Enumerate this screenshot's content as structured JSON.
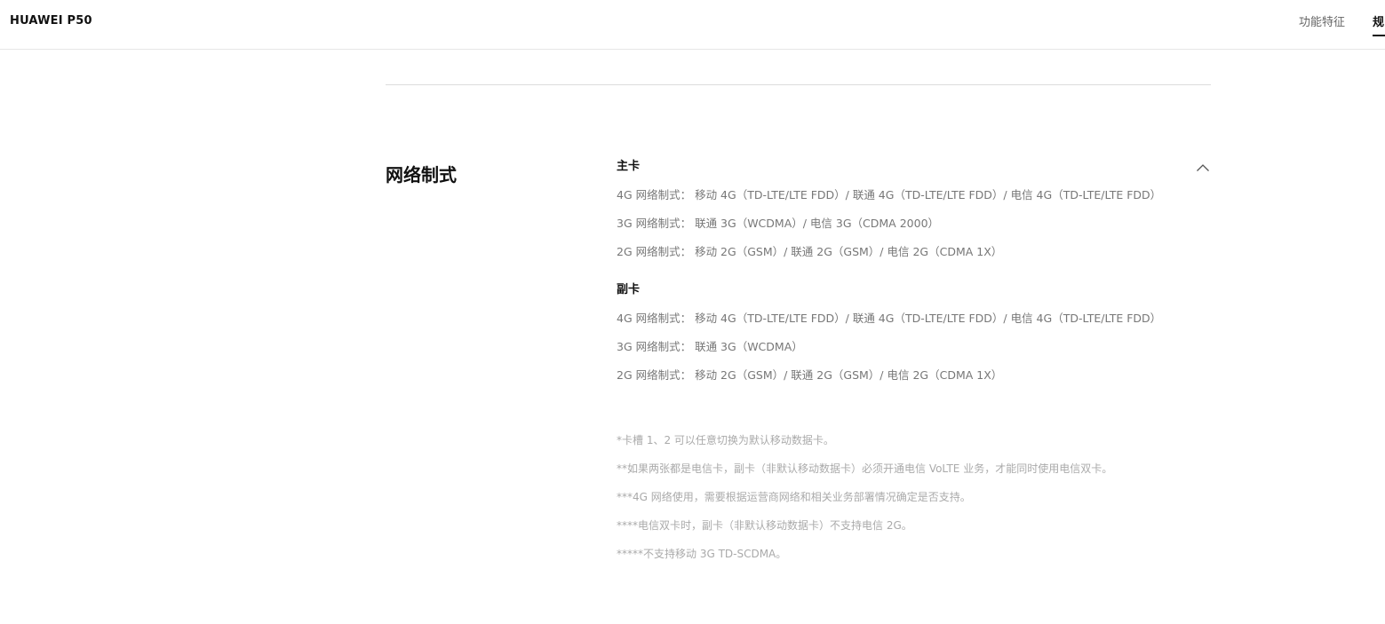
{
  "header": {
    "brand": "HUAWEI P50",
    "nav": {
      "features": "功能特征",
      "specs": "规"
    }
  },
  "section": {
    "title": "网络制式",
    "toggle_icon": "chevron-up-icon",
    "groups": [
      {
        "title": "主卡",
        "lines": [
          "4G 网络制式： 移动 4G（TD-LTE/LTE FDD）/ 联通 4G（TD-LTE/LTE FDD）/ 电信 4G（TD-LTE/LTE FDD）",
          "3G 网络制式： 联通 3G（WCDMA）/ 电信 3G（CDMA 2000）",
          "2G 网络制式： 移动 2G（GSM）/ 联通 2G（GSM）/ 电信 2G（CDMA 1X）"
        ]
      },
      {
        "title": "副卡",
        "lines": [
          "4G 网络制式： 移动 4G（TD-LTE/LTE FDD）/ 联通 4G（TD-LTE/LTE FDD）/ 电信 4G（TD-LTE/LTE FDD）",
          "3G 网络制式： 联通 3G（WCDMA）",
          "2G 网络制式： 移动 2G（GSM）/ 联通 2G（GSM）/ 电信 2G（CDMA 1X）"
        ]
      }
    ],
    "notes": [
      "*卡槽 1、2 可以任意切换为默认移动数据卡。",
      "**如果两张都是电信卡，副卡（非默认移动数据卡）必须开通电信 VoLTE 业务，才能同时使用电信双卡。",
      "***4G 网络使用，需要根据运营商网络和相关业务部署情况确定是否支持。",
      "****电信双卡时，副卡（非默认移动数据卡）不支持电信 2G。",
      "*****不支持移动 3G TD-SCDMA。"
    ]
  }
}
